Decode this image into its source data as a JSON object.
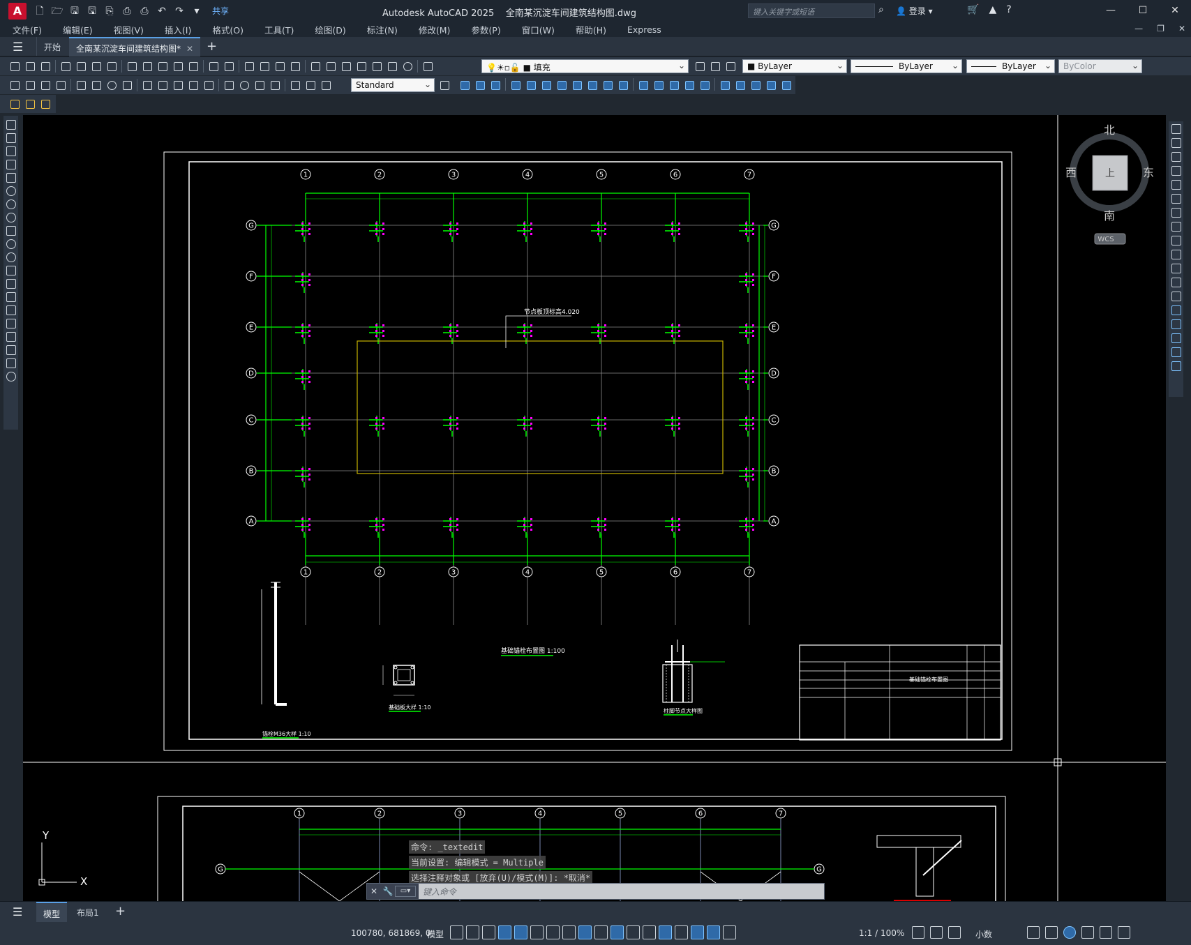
{
  "app": {
    "logo_letter": "A",
    "window_title": "Autodesk AutoCAD 2025",
    "file_name": "全南某沉淀车间建筑结构图.dwg",
    "share_label": "共享",
    "search_placeholder": "键入关键字或短语",
    "login_label": "登录"
  },
  "menu": [
    "文件(F)",
    "编辑(E)",
    "视图(V)",
    "插入(I)",
    "格式(O)",
    "工具(T)",
    "绘图(D)",
    "标注(N)",
    "修改(M)",
    "参数(P)",
    "窗口(W)",
    "帮助(H)",
    "Express"
  ],
  "tabs": {
    "start": "开始",
    "active": "全南某沉淀车间建筑结构图*"
  },
  "toolbar": {
    "layer_name": "填充",
    "color": "ByLayer",
    "linetype": "ByLayer",
    "lineweight": "ByLayer",
    "plotstyle": "ByColor",
    "dimstyle": "Standard"
  },
  "viewcube": {
    "north": "北",
    "south": "南",
    "east": "东",
    "west": "西",
    "face": "上",
    "wcs": "WCS"
  },
  "drawing": {
    "grid_numbers": [
      "1",
      "2",
      "3",
      "4",
      "5",
      "6",
      "7"
    ],
    "grid_letters": [
      "G",
      "F",
      "E",
      "D",
      "C",
      "B",
      "A"
    ],
    "elevation_note": "节点板顶标高4.020",
    "plan_title": "基础锚栓布置图",
    "plan_scale": "1:100",
    "detail1_title": "锚栓M36大样",
    "detail1_scale": "1:10",
    "detail2_title": "基础板大样",
    "detail2_scale": "1:10",
    "detail3_title": "柱脚节点大样图",
    "titleblock_drawing": "基础锚栓布置图"
  },
  "ucs": {
    "x": "X",
    "y": "Y"
  },
  "command": {
    "history": [
      "命令:  _textedit",
      "当前设置: 编辑模式 = Multiple",
      "选择注释对象或 [放弃(U)/模式(M)]: *取消*"
    ],
    "placeholder": "键入命令"
  },
  "layouts": {
    "model": "模型",
    "layout1": "布局1"
  },
  "status": {
    "coords": "100780, 681869, 0",
    "mode": "模型",
    "annoscale": "1:1 / 100%",
    "units": "小数"
  },
  "colors": {
    "grid_green": "#00ff00",
    "anchor_magenta": "#ff00ff",
    "highlight_yellow": "#c8b400",
    "axis_white": "#ffffff",
    "active_tab_accent": "#5aa0e6"
  }
}
